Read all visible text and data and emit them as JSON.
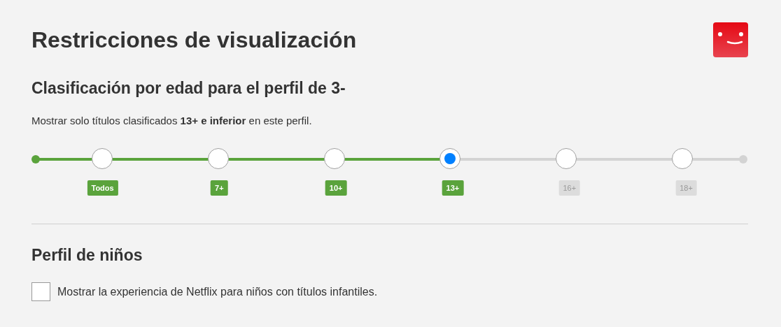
{
  "title": "Restricciones de visualización",
  "rating": {
    "heading": "Clasificación por edad para el perfil de 3-",
    "description": "Mostrar solo títulos clasificados **13+ e inferior** en este perfil.",
    "level": 0.585,
    "stops": [
      {
        "label": "Todos",
        "selected": false,
        "included": true
      },
      {
        "label": "7+",
        "selected": false,
        "included": true
      },
      {
        "label": "10+",
        "selected": false,
        "included": true
      },
      {
        "label": "13+",
        "selected": true,
        "included": true
      },
      {
        "label": "16+",
        "selected": false,
        "included": false
      },
      {
        "label": "18+",
        "selected": false,
        "included": false
      }
    ]
  },
  "kids": {
    "heading": "Perfil de niños",
    "checkbox": {
      "label": "Mostrar la experiencia de Netflix para niños con títulos infantiles.",
      "checked": false
    }
  }
}
